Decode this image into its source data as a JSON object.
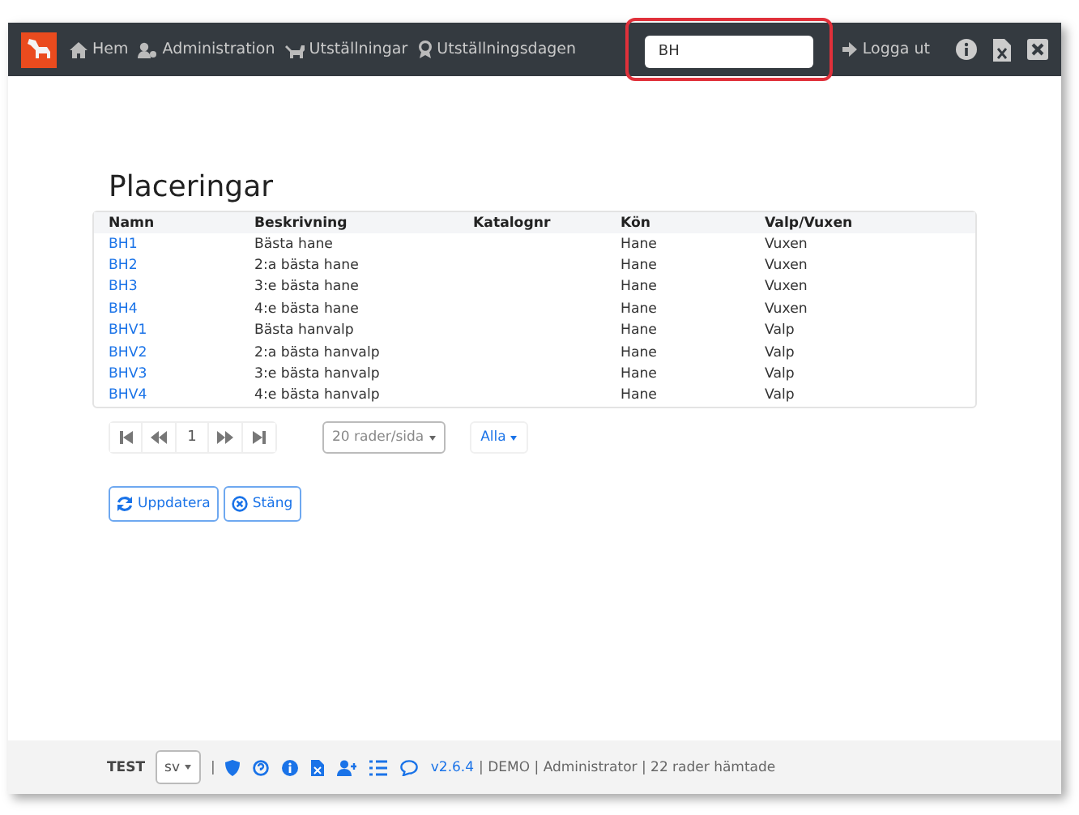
{
  "navbar": {
    "items": [
      "Hem",
      "Administration",
      "Utställningar",
      "Utställningsdagen"
    ],
    "search": {
      "value": "BH",
      "highlighted": true
    },
    "logout": "Logga ut"
  },
  "title": "Placeringar",
  "table": {
    "columns": [
      "Namn",
      "Beskrivning",
      "Katalognr",
      "Kön",
      "Valp/Vuxen"
    ],
    "rows": [
      {
        "name": "BH1",
        "description": "Bästa hane",
        "sex": "Hane",
        "age": "Vuxen"
      },
      {
        "name": "BH2",
        "description": "2:a bästa hane",
        "sex": "Hane",
        "age": "Vuxen"
      },
      {
        "name": "BH3",
        "description": "3:e bästa hane",
        "sex": "Hane",
        "age": "Vuxen"
      },
      {
        "name": "BH4",
        "description": "4:e bästa hane",
        "sex": "Hane",
        "age": "Vuxen"
      },
      {
        "name": "BHV1",
        "description": "Bästa hanvalp",
        "sex": "Hane",
        "age": "Valp"
      },
      {
        "name": "BHV2",
        "description": "2:a bästa hanvalp",
        "sex": "Hane",
        "age": "Valp"
      },
      {
        "name": "BHV3",
        "description": "3:e bästa hanvalp",
        "sex": "Hane",
        "age": "Valp"
      },
      {
        "name": "BHV4",
        "description": "4:e bästa hanvalp",
        "sex": "Hane",
        "age": "Valp"
      }
    ]
  },
  "pagination": {
    "page": "1",
    "page_size": "20 rader/sida",
    "filter": "Alla"
  },
  "buttons": [
    "Uppdatera",
    "Stäng"
  ],
  "footer": {
    "env": "TEST",
    "language": "sv",
    "divider": "|",
    "version": "v2.6.4",
    "status": "| DEMO | Administrator | 22 rader hämtade"
  }
}
